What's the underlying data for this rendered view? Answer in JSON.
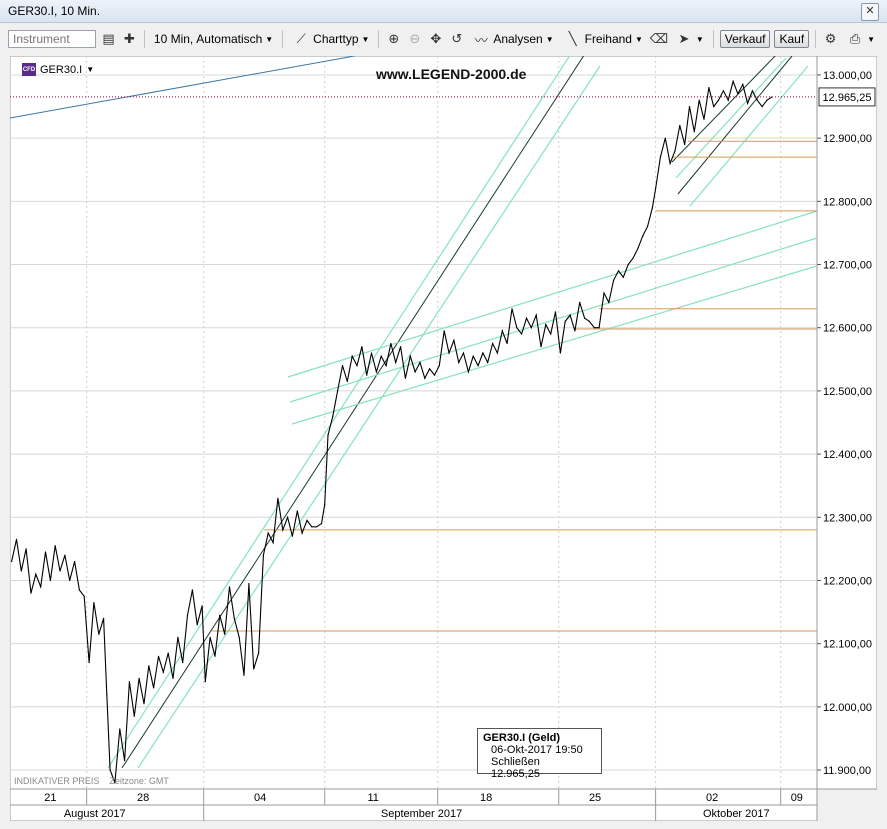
{
  "window": {
    "title": "GER30.I, 10 Min."
  },
  "toolbar": {
    "instrument_placeholder": "Instrument",
    "interval_label": "10 Min,",
    "mode_label": "Automatisch",
    "charttype_label": "Charttyp",
    "analysen_label": "Analysen",
    "freihand_label": "Freihand",
    "verkauf_label": "Verkauf",
    "kauf_label": "Kauf"
  },
  "chart": {
    "symbol": "GER30.I",
    "watermark": "www.LEGEND-2000.de",
    "indikativ": "INDIKATIVER PREIS",
    "timezone": "Zeitzone: GMT",
    "current_price_label": "12.965,25",
    "tooltip": {
      "title": "GER30.I (Geld)",
      "date": "06-Okt-2017 19:50",
      "close_label": "Schließen",
      "close_value": "12.965,25"
    },
    "colors": {
      "price_line": "#000000",
      "channel_dark": "#1a3a2a",
      "channel_light": "#86e3b8",
      "support": "#d59a55",
      "trend_blue": "#3a78a8",
      "current_price": "#a0004a"
    }
  },
  "chart_data": {
    "type": "line",
    "ylim": [
      11870,
      13030
    ],
    "y_ticks": [
      {
        "value": 11900,
        "label": "11.900,00"
      },
      {
        "value": 12000,
        "label": "12.000,00"
      },
      {
        "value": 12100,
        "label": "12.100,00"
      },
      {
        "value": 12200,
        "label": "12.200,00"
      },
      {
        "value": 12300,
        "label": "12.300,00"
      },
      {
        "value": 12400,
        "label": "12.400,00"
      },
      {
        "value": 12500,
        "label": "12.500,00"
      },
      {
        "value": 12600,
        "label": "12.600,00"
      },
      {
        "value": 12700,
        "label": "12.700,00"
      },
      {
        "value": 12800,
        "label": "12.800,00"
      },
      {
        "value": 12900,
        "label": "12.900,00"
      },
      {
        "value": 13000,
        "label": "13.000,00"
      }
    ],
    "x_ticks": [
      {
        "pos": 0.05,
        "label": "21"
      },
      {
        "pos": 0.165,
        "label": "28"
      },
      {
        "pos": 0.31,
        "label": "04"
      },
      {
        "pos": 0.45,
        "label": "11"
      },
      {
        "pos": 0.59,
        "label": "18"
      },
      {
        "pos": 0.725,
        "label": "25"
      },
      {
        "pos": 0.87,
        "label": "02"
      },
      {
        "pos": 0.975,
        "label": "09"
      }
    ],
    "x_separators": [
      0.095,
      0.24,
      0.39,
      0.53,
      0.68,
      0.8,
      0.955
    ],
    "month_labels": [
      {
        "pos": 0.105,
        "label": "August 2017"
      },
      {
        "pos": 0.51,
        "label": "September 2017"
      },
      {
        "pos": 0.9,
        "label": "Oktober 2017"
      }
    ],
    "month_separators": [
      0.24,
      0.8
    ],
    "current_price": 12965.25,
    "support_lines": [
      {
        "x0": 0.315,
        "value": 12280
      },
      {
        "x0": 0.25,
        "value": 12120
      },
      {
        "x0": 0.73,
        "value": 12630
      },
      {
        "x0": 0.7,
        "value": 12598
      },
      {
        "x0": 0.8,
        "value": 12785
      },
      {
        "x0": 0.82,
        "value": 12870
      },
      {
        "x0": 0.84,
        "value": 12895
      }
    ],
    "series": [
      {
        "points": [
          [
            0.002,
            12230
          ],
          [
            0.008,
            12265
          ],
          [
            0.014,
            12215
          ],
          [
            0.02,
            12250
          ],
          [
            0.026,
            12180
          ],
          [
            0.032,
            12210
          ],
          [
            0.038,
            12190
          ],
          [
            0.044,
            12245
          ],
          [
            0.05,
            12200
          ],
          [
            0.056,
            12255
          ],
          [
            0.062,
            12215
          ],
          [
            0.068,
            12240
          ],
          [
            0.074,
            12200
          ],
          [
            0.08,
            12230
          ],
          [
            0.086,
            12185
          ],
          [
            0.092,
            12175
          ],
          [
            0.098,
            12070
          ],
          [
            0.104,
            12165
          ],
          [
            0.11,
            12115
          ],
          [
            0.116,
            12140
          ],
          [
            0.12,
            12020
          ],
          [
            0.124,
            11900
          ],
          [
            0.13,
            11880
          ],
          [
            0.136,
            11965
          ],
          [
            0.142,
            11915
          ],
          [
            0.148,
            12040
          ],
          [
            0.154,
            11985
          ],
          [
            0.16,
            12045
          ],
          [
            0.166,
            12005
          ],
          [
            0.172,
            12065
          ],
          [
            0.178,
            12030
          ],
          [
            0.184,
            12080
          ],
          [
            0.19,
            12055
          ],
          [
            0.196,
            12085
          ],
          [
            0.202,
            12045
          ],
          [
            0.208,
            12110
          ],
          [
            0.214,
            12070
          ],
          [
            0.22,
            12145
          ],
          [
            0.226,
            12185
          ],
          [
            0.232,
            12130
          ],
          [
            0.238,
            12160
          ],
          [
            0.242,
            12040
          ],
          [
            0.248,
            12110
          ],
          [
            0.254,
            12080
          ],
          [
            0.26,
            12145
          ],
          [
            0.266,
            12115
          ],
          [
            0.272,
            12190
          ],
          [
            0.278,
            12140
          ],
          [
            0.284,
            12110
          ],
          [
            0.29,
            12050
          ],
          [
            0.296,
            12195
          ],
          [
            0.302,
            12060
          ],
          [
            0.308,
            12085
          ],
          [
            0.314,
            12240
          ],
          [
            0.32,
            12275
          ],
          [
            0.326,
            12260
          ],
          [
            0.332,
            12330
          ],
          [
            0.338,
            12280
          ],
          [
            0.344,
            12300
          ],
          [
            0.35,
            12270
          ],
          [
            0.356,
            12310
          ],
          [
            0.362,
            12275
          ],
          [
            0.368,
            12295
          ],
          [
            0.374,
            12285
          ],
          [
            0.38,
            12285
          ],
          [
            0.386,
            12290
          ],
          [
            0.39,
            12320
          ],
          [
            0.394,
            12430
          ],
          [
            0.4,
            12460
          ],
          [
            0.406,
            12500
          ],
          [
            0.412,
            12540
          ],
          [
            0.418,
            12515
          ],
          [
            0.424,
            12555
          ],
          [
            0.43,
            12540
          ],
          [
            0.436,
            12570
          ],
          [
            0.442,
            12525
          ],
          [
            0.448,
            12560
          ],
          [
            0.454,
            12530
          ],
          [
            0.46,
            12555
          ],
          [
            0.466,
            12540
          ],
          [
            0.472,
            12575
          ],
          [
            0.478,
            12545
          ],
          [
            0.484,
            12570
          ],
          [
            0.49,
            12520
          ],
          [
            0.496,
            12555
          ],
          [
            0.502,
            12530
          ],
          [
            0.508,
            12545
          ],
          [
            0.514,
            12520
          ],
          [
            0.52,
            12535
          ],
          [
            0.526,
            12525
          ],
          [
            0.532,
            12540
          ],
          [
            0.538,
            12595
          ],
          [
            0.544,
            12560
          ],
          [
            0.55,
            12580
          ],
          [
            0.556,
            12545
          ],
          [
            0.562,
            12560
          ],
          [
            0.568,
            12530
          ],
          [
            0.574,
            12555
          ],
          [
            0.58,
            12540
          ],
          [
            0.586,
            12560
          ],
          [
            0.592,
            12545
          ],
          [
            0.598,
            12575
          ],
          [
            0.604,
            12560
          ],
          [
            0.61,
            12595
          ],
          [
            0.616,
            12575
          ],
          [
            0.622,
            12630
          ],
          [
            0.628,
            12600
          ],
          [
            0.634,
            12590
          ],
          [
            0.64,
            12615
          ],
          [
            0.646,
            12600
          ],
          [
            0.652,
            12620
          ],
          [
            0.658,
            12570
          ],
          [
            0.664,
            12605
          ],
          [
            0.67,
            12590
          ],
          [
            0.676,
            12625
          ],
          [
            0.682,
            12560
          ],
          [
            0.688,
            12610
          ],
          [
            0.694,
            12620
          ],
          [
            0.7,
            12595
          ],
          [
            0.706,
            12640
          ],
          [
            0.712,
            12615
          ],
          [
            0.718,
            12610
          ],
          [
            0.724,
            12600
          ],
          [
            0.73,
            12600
          ],
          [
            0.736,
            12655
          ],
          [
            0.742,
            12640
          ],
          [
            0.748,
            12675
          ],
          [
            0.754,
            12690
          ],
          [
            0.76,
            12680
          ],
          [
            0.766,
            12700
          ],
          [
            0.772,
            12710
          ],
          [
            0.778,
            12725
          ],
          [
            0.784,
            12745
          ],
          [
            0.79,
            12760
          ],
          [
            0.796,
            12790
          ],
          [
            0.8,
            12820
          ],
          [
            0.806,
            12870
          ],
          [
            0.812,
            12900
          ],
          [
            0.818,
            12860
          ],
          [
            0.824,
            12880
          ],
          [
            0.83,
            12920
          ],
          [
            0.836,
            12890
          ],
          [
            0.842,
            12950
          ],
          [
            0.848,
            12910
          ],
          [
            0.854,
            12960
          ],
          [
            0.86,
            12930
          ],
          [
            0.866,
            12980
          ],
          [
            0.872,
            12950
          ],
          [
            0.878,
            12960
          ],
          [
            0.884,
            12975
          ],
          [
            0.89,
            12960
          ],
          [
            0.896,
            12990
          ],
          [
            0.902,
            12970
          ],
          [
            0.908,
            12985
          ],
          [
            0.914,
            12955
          ],
          [
            0.92,
            12975
          ],
          [
            0.926,
            12960
          ],
          [
            0.932,
            12950
          ],
          [
            0.938,
            12960
          ],
          [
            0.944,
            12965
          ]
        ]
      }
    ]
  }
}
